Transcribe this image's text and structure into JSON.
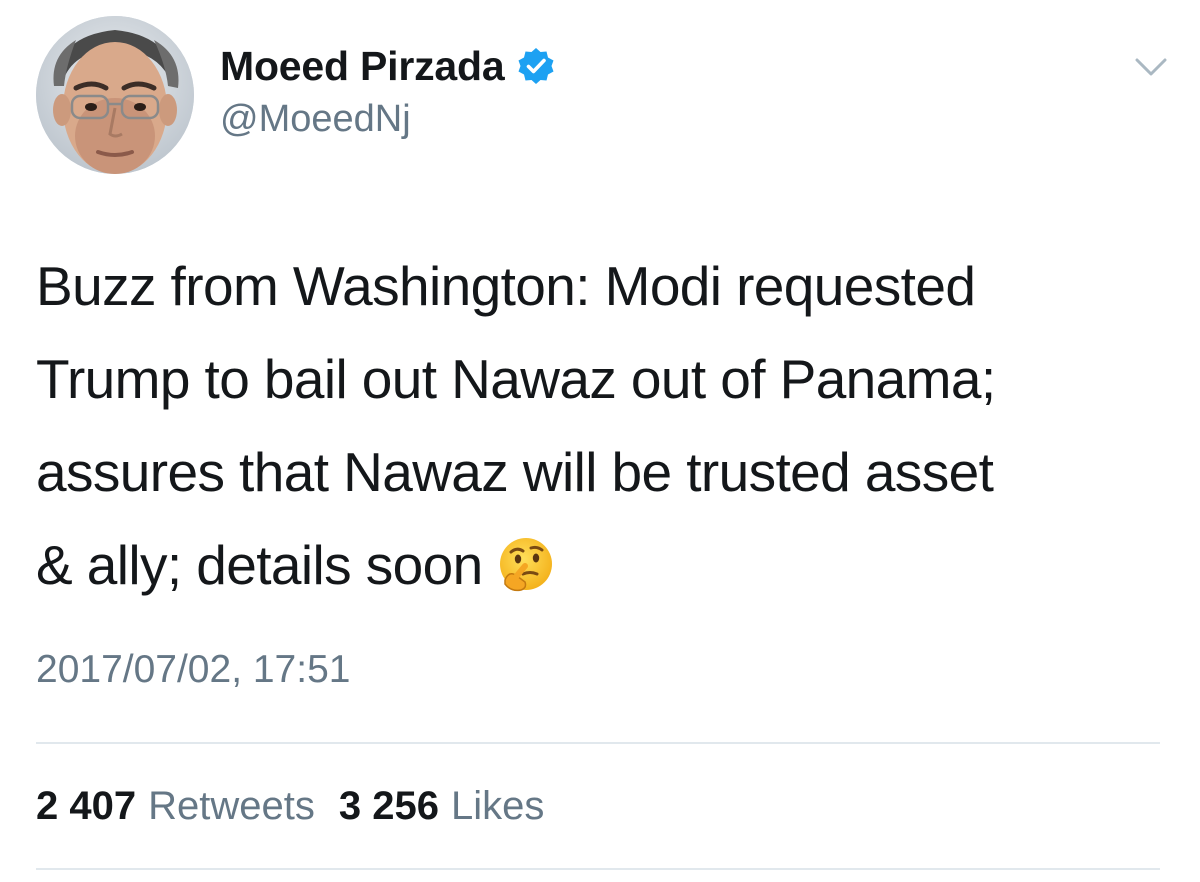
{
  "author": {
    "display_name": "Moeed Pirzada",
    "handle": "@MoeedNj",
    "verified": true
  },
  "tweet": {
    "text_lines": [
      "Buzz from Washington: Modi requested",
      "Trump to bail out Nawaz out of Panama;",
      "assures that Nawaz will be trusted asset",
      "& ally; details soon"
    ],
    "emoji": "thinking-face-icon",
    "timestamp": "2017/07/02, 17:51"
  },
  "stats": {
    "retweets_count": "2 407",
    "retweets_label": "Retweets",
    "likes_count": "3 256",
    "likes_label": "Likes"
  },
  "colors": {
    "text": "#14171a",
    "secondary": "#657786",
    "verified_blue": "#1da1f2",
    "divider": "#e1e8ed"
  }
}
